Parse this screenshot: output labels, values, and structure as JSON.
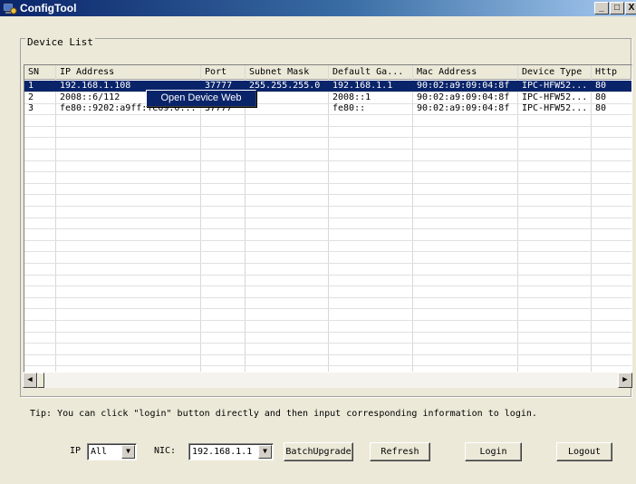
{
  "window": {
    "title": "ConfigTool"
  },
  "titlebar_buttons": {
    "minimize": "_",
    "maximize": "□",
    "close": "X"
  },
  "device_list": {
    "group_label": "Device List",
    "columns": [
      "SN",
      "IP Address",
      "Port",
      "Subnet Mask",
      "Default Ga...",
      "Mac Address",
      "Device Type",
      "Http"
    ],
    "rows": [
      [
        "1",
        "192.168.1.108",
        "37777",
        "255.255.255.0",
        "192.168.1.1",
        "90:02:a9:09:04:8f",
        "IPC-HFW52...",
        "80"
      ],
      [
        "2",
        "2008::6/112",
        "",
        "",
        "2008::1",
        "90:02:a9:09:04:8f",
        "IPC-HFW52...",
        "80"
      ],
      [
        "3",
        "fe80::9202:a9ff:fe09:0...",
        "37777",
        "",
        "fe80::",
        "90:02:a9:09:04:8f",
        "IPC-HFW52...",
        "80"
      ]
    ],
    "selected_row": 0
  },
  "context_menu": {
    "items": [
      "Open Device Web"
    ]
  },
  "scrollbar": {
    "left_arrow": "◀",
    "right_arrow": "▶"
  },
  "tip": "Tip: You can click \"login\" button directly and then input corresponding information to login.",
  "controls": {
    "ip_label": "IP",
    "ip_value": "All",
    "nic_label": "NIC:",
    "nic_value": "192.168.1.1",
    "dropdown_arrow": "▼",
    "batch_upgrade": "BatchUpgrade",
    "refresh": "Refresh",
    "login": "Login",
    "logout": "Logout"
  }
}
